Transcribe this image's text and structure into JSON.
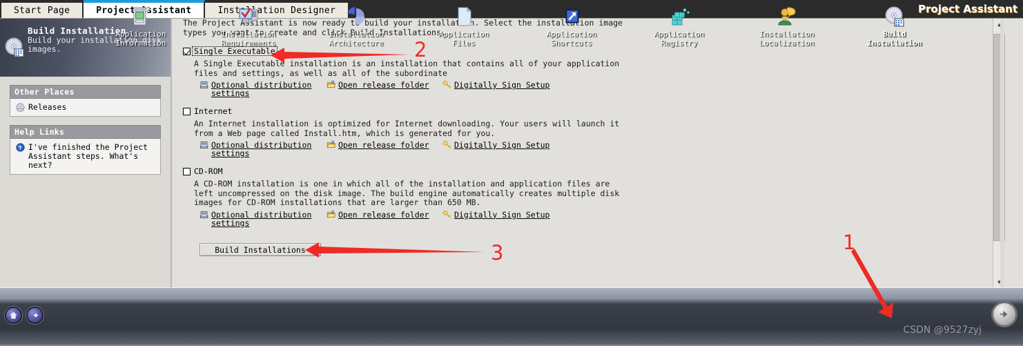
{
  "window": {
    "title": "Project Assistant",
    "tabs": [
      {
        "label": "Start Page",
        "active": false
      },
      {
        "label": "Project Assistant",
        "active": true
      },
      {
        "label": "Installation Designer",
        "active": false
      }
    ]
  },
  "banner": {
    "title": "Build Installation",
    "subtitle": "Build your installation disk images.",
    "icon": "cd-disk-icon"
  },
  "sidebar": {
    "panels": [
      {
        "heading": "Other Places",
        "items": [
          {
            "label": "Releases",
            "icon": "cd-disk-icon"
          }
        ]
      },
      {
        "heading": "Help Links",
        "items": [
          {
            "label": "I've finished the Project Assistant steps. What's next?",
            "icon": "help-question-icon"
          }
        ]
      }
    ]
  },
  "main": {
    "intro": "The Project Assistant is now ready to build your installation. Select the installation image types you want to create and click Build Installations.",
    "groups": [
      {
        "id": "single-executable",
        "label": "Single Executable",
        "checked": true,
        "focused": true,
        "description": "A Single Executable installation is an installation that contains all of your application files and settings, as well as all of the subordinate",
        "links": [
          {
            "label": "Optional distribution\nsettings",
            "icon": "distribution-settings-icon"
          },
          {
            "label": "Open release folder",
            "icon": "open-folder-icon"
          },
          {
            "label": "Digitally Sign Setup",
            "icon": "key-icon"
          }
        ]
      },
      {
        "id": "internet",
        "label": "Internet",
        "checked": false,
        "focused": false,
        "description": "An Internet installation is optimized for Internet downloading. Your users will launch it from a Web page called Install.htm, which is generated for you.",
        "links": [
          {
            "label": "Optional distribution\nsettings",
            "icon": "distribution-settings-icon"
          },
          {
            "label": "Open release folder",
            "icon": "open-folder-icon"
          },
          {
            "label": "Digitally Sign Setup",
            "icon": "key-icon"
          }
        ]
      },
      {
        "id": "cd-rom",
        "label": "CD-ROM",
        "checked": false,
        "focused": false,
        "description": "A CD-ROM installation is one in which all of the installation and application files are left uncompressed on the disk image. The build engine automatically creates multiple disk images for CD-ROM installations that are larger than 650 MB.",
        "links": [
          {
            "label": "Optional distribution\nsettings",
            "icon": "distribution-settings-icon"
          },
          {
            "label": "Open release folder",
            "icon": "open-folder-icon"
          },
          {
            "label": "Digitally Sign Setup",
            "icon": "key-icon"
          }
        ]
      }
    ],
    "build_button": "Build Installations"
  },
  "taskbar": {
    "nav": {
      "home": "home-icon",
      "back": "back-arrow-icon",
      "forward": "forward-arrow-icon"
    },
    "items": [
      {
        "label": "Application\nInformation",
        "icon": "application-information-icon",
        "active": false
      },
      {
        "label": "Installation\nRequirements",
        "icon": "installation-requirements-icon",
        "active": false
      },
      {
        "label": "Installation\nArchitecture",
        "icon": "installation-architecture-icon",
        "active": false
      },
      {
        "label": "Application\nFiles",
        "icon": "application-files-icon",
        "active": false
      },
      {
        "label": "Application\nShortcuts",
        "icon": "application-shortcuts-icon",
        "active": false
      },
      {
        "label": "Application\nRegistry",
        "icon": "application-registry-icon",
        "active": false
      },
      {
        "label": "Installation\nLocalization",
        "icon": "installation-localization-icon",
        "active": false
      },
      {
        "label": "Build\nInstallation",
        "icon": "build-installation-icon",
        "active": true
      }
    ]
  },
  "annotations": {
    "color": "#ee2b24",
    "markers": [
      {
        "number": "1",
        "points_to": "build-installation-taskbar-item"
      },
      {
        "number": "2",
        "points_to": "single-executable-checkbox"
      },
      {
        "number": "3",
        "points_to": "build-installations-button"
      }
    ]
  },
  "watermark": "CSDN @9527zyj",
  "scrollbar": {
    "up": "▲",
    "down": "▼"
  }
}
